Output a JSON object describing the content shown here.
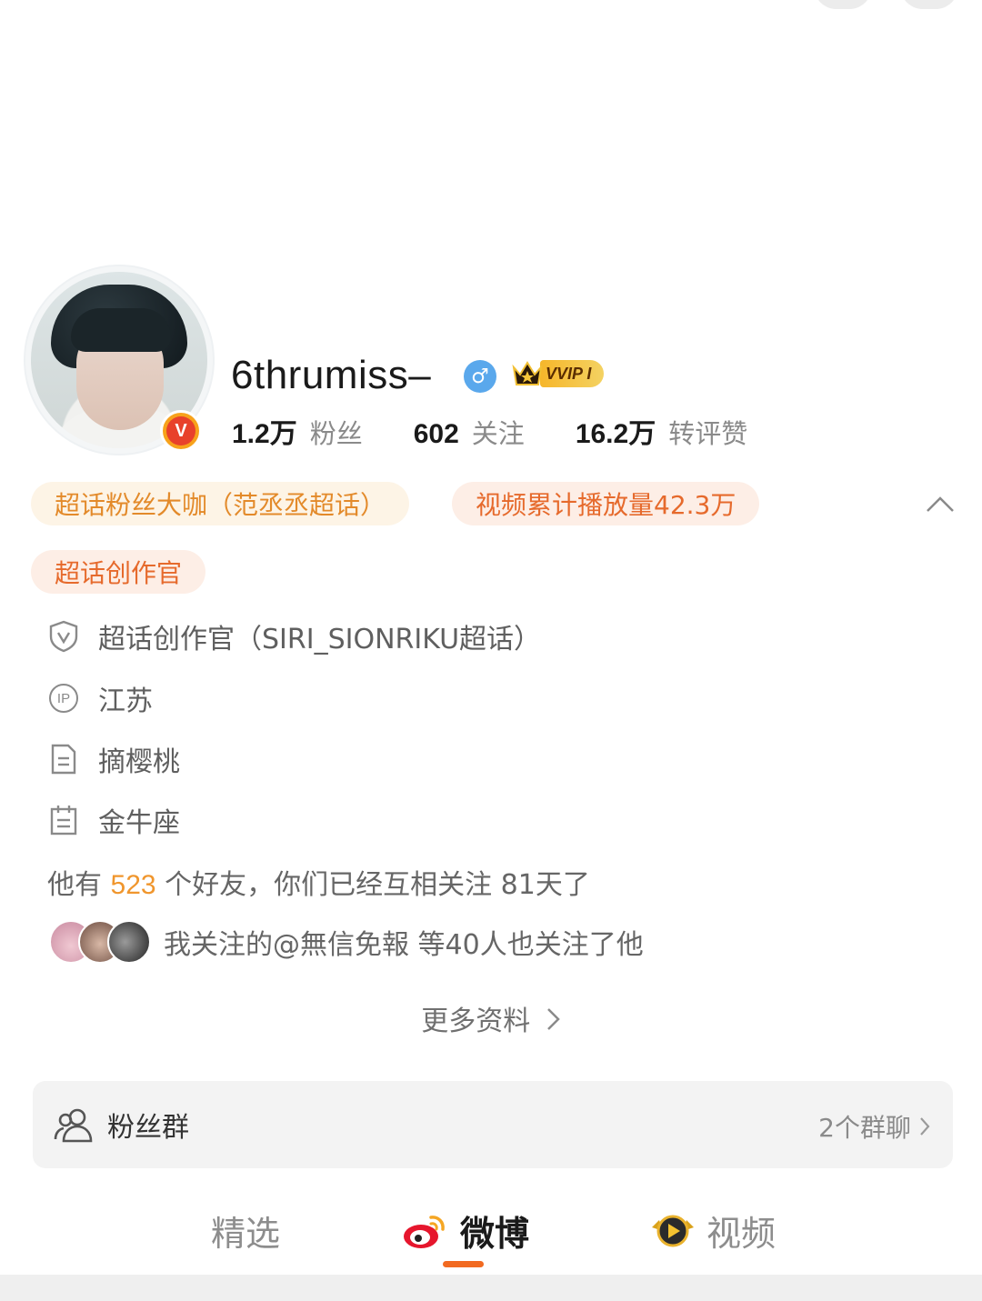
{
  "profile": {
    "username": "6thrumiss–",
    "gender_symbol": "♂",
    "vip_label": "VVIP I",
    "verified_badge": "V",
    "stats": [
      {
        "num": "1.2万",
        "label": "粉丝"
      },
      {
        "num": "602",
        "label": "关注"
      },
      {
        "num": "16.2万",
        "label": "转评赞"
      }
    ]
  },
  "tags": {
    "t1": "超话粉丝大咖（范丞丞超话）",
    "t2": "视频累计播放量42.3万",
    "t3": "超话创作官"
  },
  "info": {
    "creator": "超话创作官（SIRI_SIONRIKU超话）",
    "ip_icon_text": "IP",
    "ip": "江苏",
    "bio": "摘樱桃",
    "zodiac": "金牛座"
  },
  "friends": {
    "prefix": "他有 ",
    "count": "523",
    "suffix": " 个好友，你们已经互相关注 81天了"
  },
  "mutual": {
    "text": "我关注的@無信免報 等40人也关注了他"
  },
  "more_info": "更多资料",
  "fans_group": {
    "label": "粉丝群",
    "count": "2个群聊"
  },
  "tabs": [
    {
      "label": "精选"
    },
    {
      "label": "微博"
    },
    {
      "label": "视频"
    }
  ],
  "colors": {
    "accent": "#f26a21",
    "friend_count": "#f0962d",
    "gender": "#5aa8ec"
  }
}
